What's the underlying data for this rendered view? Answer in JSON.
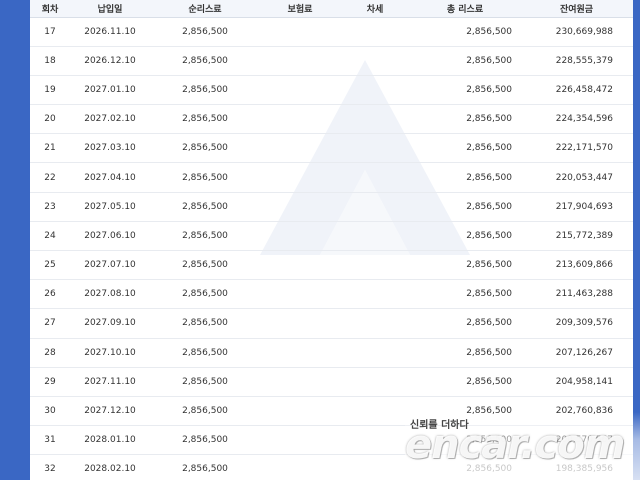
{
  "table": {
    "headers": {
      "no": "회차",
      "date": "납입일",
      "net": "순리스료",
      "insurance": "보험료",
      "car_tax": "차세",
      "total": "총 리스료",
      "remaining": "잔여원금"
    },
    "rows": [
      {
        "no": "17",
        "date": "2026.11.10",
        "net": "2,856,500",
        "insurance": "",
        "car_tax": "",
        "total": "2,856,500",
        "remaining": "230,669,988"
      },
      {
        "no": "18",
        "date": "2026.12.10",
        "net": "2,856,500",
        "insurance": "",
        "car_tax": "",
        "total": "2,856,500",
        "remaining": "228,555,379"
      },
      {
        "no": "19",
        "date": "2027.01.10",
        "net": "2,856,500",
        "insurance": "",
        "car_tax": "",
        "total": "2,856,500",
        "remaining": "226,458,472"
      },
      {
        "no": "20",
        "date": "2027.02.10",
        "net": "2,856,500",
        "insurance": "",
        "car_tax": "",
        "total": "2,856,500",
        "remaining": "224,354,596"
      },
      {
        "no": "21",
        "date": "2027.03.10",
        "net": "2,856,500",
        "insurance": "",
        "car_tax": "",
        "total": "2,856,500",
        "remaining": "222,171,570"
      },
      {
        "no": "22",
        "date": "2027.04.10",
        "net": "2,856,500",
        "insurance": "",
        "car_tax": "",
        "total": "2,856,500",
        "remaining": "220,053,447"
      },
      {
        "no": "23",
        "date": "2027.05.10",
        "net": "2,856,500",
        "insurance": "",
        "car_tax": "",
        "total": "2,856,500",
        "remaining": "217,904,693"
      },
      {
        "no": "24",
        "date": "2027.06.10",
        "net": "2,856,500",
        "insurance": "",
        "car_tax": "",
        "total": "2,856,500",
        "remaining": "215,772,389"
      },
      {
        "no": "25",
        "date": "2027.07.10",
        "net": "2,856,500",
        "insurance": "",
        "car_tax": "",
        "total": "2,856,500",
        "remaining": "213,609,866"
      },
      {
        "no": "26",
        "date": "2027.08.10",
        "net": "2,856,500",
        "insurance": "",
        "car_tax": "",
        "total": "2,856,500",
        "remaining": "211,463,288"
      },
      {
        "no": "27",
        "date": "2027.09.10",
        "net": "2,856,500",
        "insurance": "",
        "car_tax": "",
        "total": "2,856,500",
        "remaining": "209,309,576"
      },
      {
        "no": "28",
        "date": "2027.10.10",
        "net": "2,856,500",
        "insurance": "",
        "car_tax": "",
        "total": "2,856,500",
        "remaining": "207,126,267"
      },
      {
        "no": "29",
        "date": "2027.11.10",
        "net": "2,856,500",
        "insurance": "",
        "car_tax": "",
        "total": "2,856,500",
        "remaining": "204,958,141"
      },
      {
        "no": "30",
        "date": "2027.12.10",
        "net": "2,856,500",
        "insurance": "",
        "car_tax": "",
        "total": "2,856,500",
        "remaining": "202,760,836"
      },
      {
        "no": "31",
        "date": "2028.01.10",
        "net": "2,856,500",
        "insurance": "",
        "car_tax": "",
        "total": "2,856,500",
        "remaining": "200,570,567"
      },
      {
        "no": "32",
        "date": "2028.02.10",
        "net": "2,856,500",
        "insurance": "",
        "car_tax": "",
        "total": "2,856,500",
        "remaining": "198,385,956"
      }
    ]
  },
  "watermark": {
    "tagline": "신뢰를 더하다",
    "logo_text": "encar.com"
  },
  "colors": {
    "frame_blue": "#3a67c4",
    "header_bg": "#f3f6fb",
    "row_line": "#e8ebf0",
    "text": "#333333"
  }
}
